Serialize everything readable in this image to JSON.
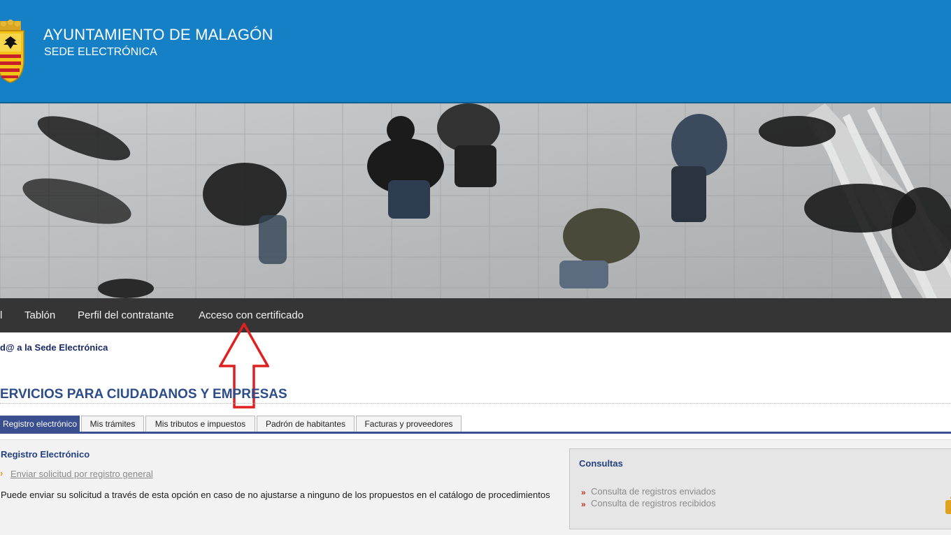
{
  "header": {
    "title": "AYUNTAMIENTO DE MALAGÓN",
    "subtitle": "SEDE ELECTRÓNICA"
  },
  "nav": {
    "items": [
      {
        "label": "l"
      },
      {
        "label": "Tablón"
      },
      {
        "label": "Perfil del contratante"
      },
      {
        "label": "Acceso con certificado"
      }
    ]
  },
  "welcome": "d@ a la Sede Electrónica",
  "services_title": "ERVICIOS PARA CIUDADANOS Y EMPRESAS",
  "tabs": [
    {
      "label": "Registro electrónico",
      "active": true
    },
    {
      "label": "Mis trámites"
    },
    {
      "label": "Mis tributos e impuestos"
    },
    {
      "label": "Padrón de habitantes"
    },
    {
      "label": "Facturas y proveedores"
    }
  ],
  "content": {
    "section_title": "Registro Electrónico",
    "link_bullet": "›",
    "link_general": "Enviar solicitud por registro general",
    "description": "Puede enviar su solicitud a través de esta opción en caso de no ajustarse a ninguno de los propuestos en el catálogo de procedimientos"
  },
  "consultas": {
    "title": "Consultas",
    "bullet": "»",
    "links": [
      {
        "label": "Consulta de registros enviados"
      },
      {
        "label": "Consulta de registros recibidos"
      }
    ]
  },
  "colors": {
    "header_bg": "#1580c6",
    "nav_bg": "#353535",
    "tab_active": "#3a4f8f",
    "arrow": "#e02020"
  },
  "icons": {
    "crest": "coat-of-arms-icon",
    "arrow": "up-arrow-annotation-icon",
    "padlock": "padlock-icon"
  }
}
